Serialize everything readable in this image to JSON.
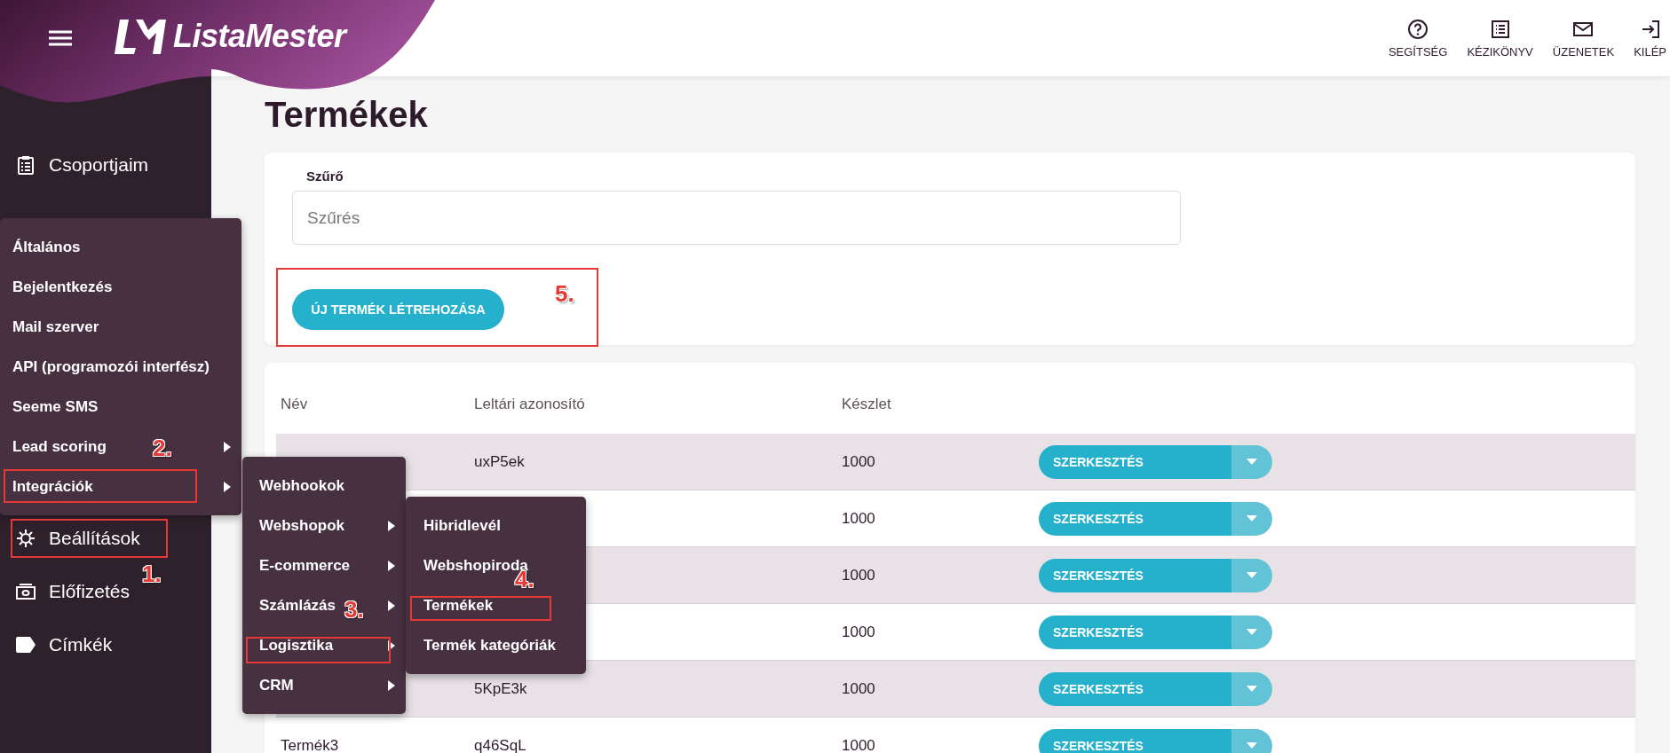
{
  "header": {
    "logo": "ListaMester",
    "actions": [
      {
        "label": "SEGÍTSÉG",
        "kind": "help"
      },
      {
        "label": "KÉZIKÖNYV",
        "kind": "list"
      },
      {
        "label": "ÜZENETEK",
        "kind": "mail"
      },
      {
        "label": "KILÉP",
        "kind": "exit"
      }
    ]
  },
  "sidebar": {
    "items": [
      {
        "label": "Csoportjaim",
        "kind": "clipboard"
      },
      {
        "label": "Beállítások",
        "kind": "gear"
      },
      {
        "label": "Előfizetés",
        "kind": "money"
      },
      {
        "label": "Címkék",
        "kind": "tag"
      }
    ]
  },
  "page": {
    "title": "Termékek",
    "filter": {
      "label": "Szűrő",
      "placeholder": "Szűrés"
    },
    "create_button": "ÚJ TERMÉK LÉTREHOZÁSA"
  },
  "table": {
    "columns": [
      "Név",
      "Leltári azonosító",
      "Készlet"
    ],
    "rows": [
      {
        "id": "uxP5ek",
        "stock": "1000",
        "action": "SZERKESZTÉS"
      },
      {
        "stock": "1000",
        "action": "SZERKESZTÉS"
      },
      {
        "stock": "1000",
        "action": "SZERKESZTÉS"
      },
      {
        "stock": "1000",
        "action": "SZERKESZTÉS"
      },
      {
        "id": "5KpE3k",
        "stock": "1000",
        "action": "SZERKESZTÉS"
      },
      {
        "name": "Termék3",
        "id": "q46SqL",
        "stock": "1000",
        "action": "SZERKESZTÉS"
      }
    ]
  },
  "menus": [
    {
      "items": [
        {
          "label": "Általános",
          "submenu": false
        },
        {
          "label": "Bejelentkezés",
          "submenu": false
        },
        {
          "label": "Mail szerver",
          "submenu": false
        },
        {
          "label": "API (programozói interfész)",
          "submenu": false
        },
        {
          "label": "Seeme SMS",
          "submenu": false
        },
        {
          "label": "Lead scoring",
          "submenu": true
        },
        {
          "label": "Integrációk",
          "submenu": true
        }
      ]
    },
    {
      "items": [
        {
          "label": "Webhookok",
          "submenu": false
        },
        {
          "label": "Webshopok",
          "submenu": true
        },
        {
          "label": "E-commerce",
          "submenu": true
        },
        {
          "label": "Számlázás",
          "submenu": true
        },
        {
          "label": "Logisztika",
          "submenu": true
        },
        {
          "label": "CRM",
          "submenu": true
        }
      ]
    },
    {
      "items": [
        {
          "label": "Hibridlevél",
          "submenu": false
        },
        {
          "label": "Webshopiroda",
          "submenu": false
        },
        {
          "label": "Termékek",
          "submenu": false
        },
        {
          "label": "Termék kategóriák",
          "submenu": false
        }
      ]
    }
  ],
  "annotations": [
    "1.",
    "2.",
    "3.",
    "4.",
    "5."
  ]
}
